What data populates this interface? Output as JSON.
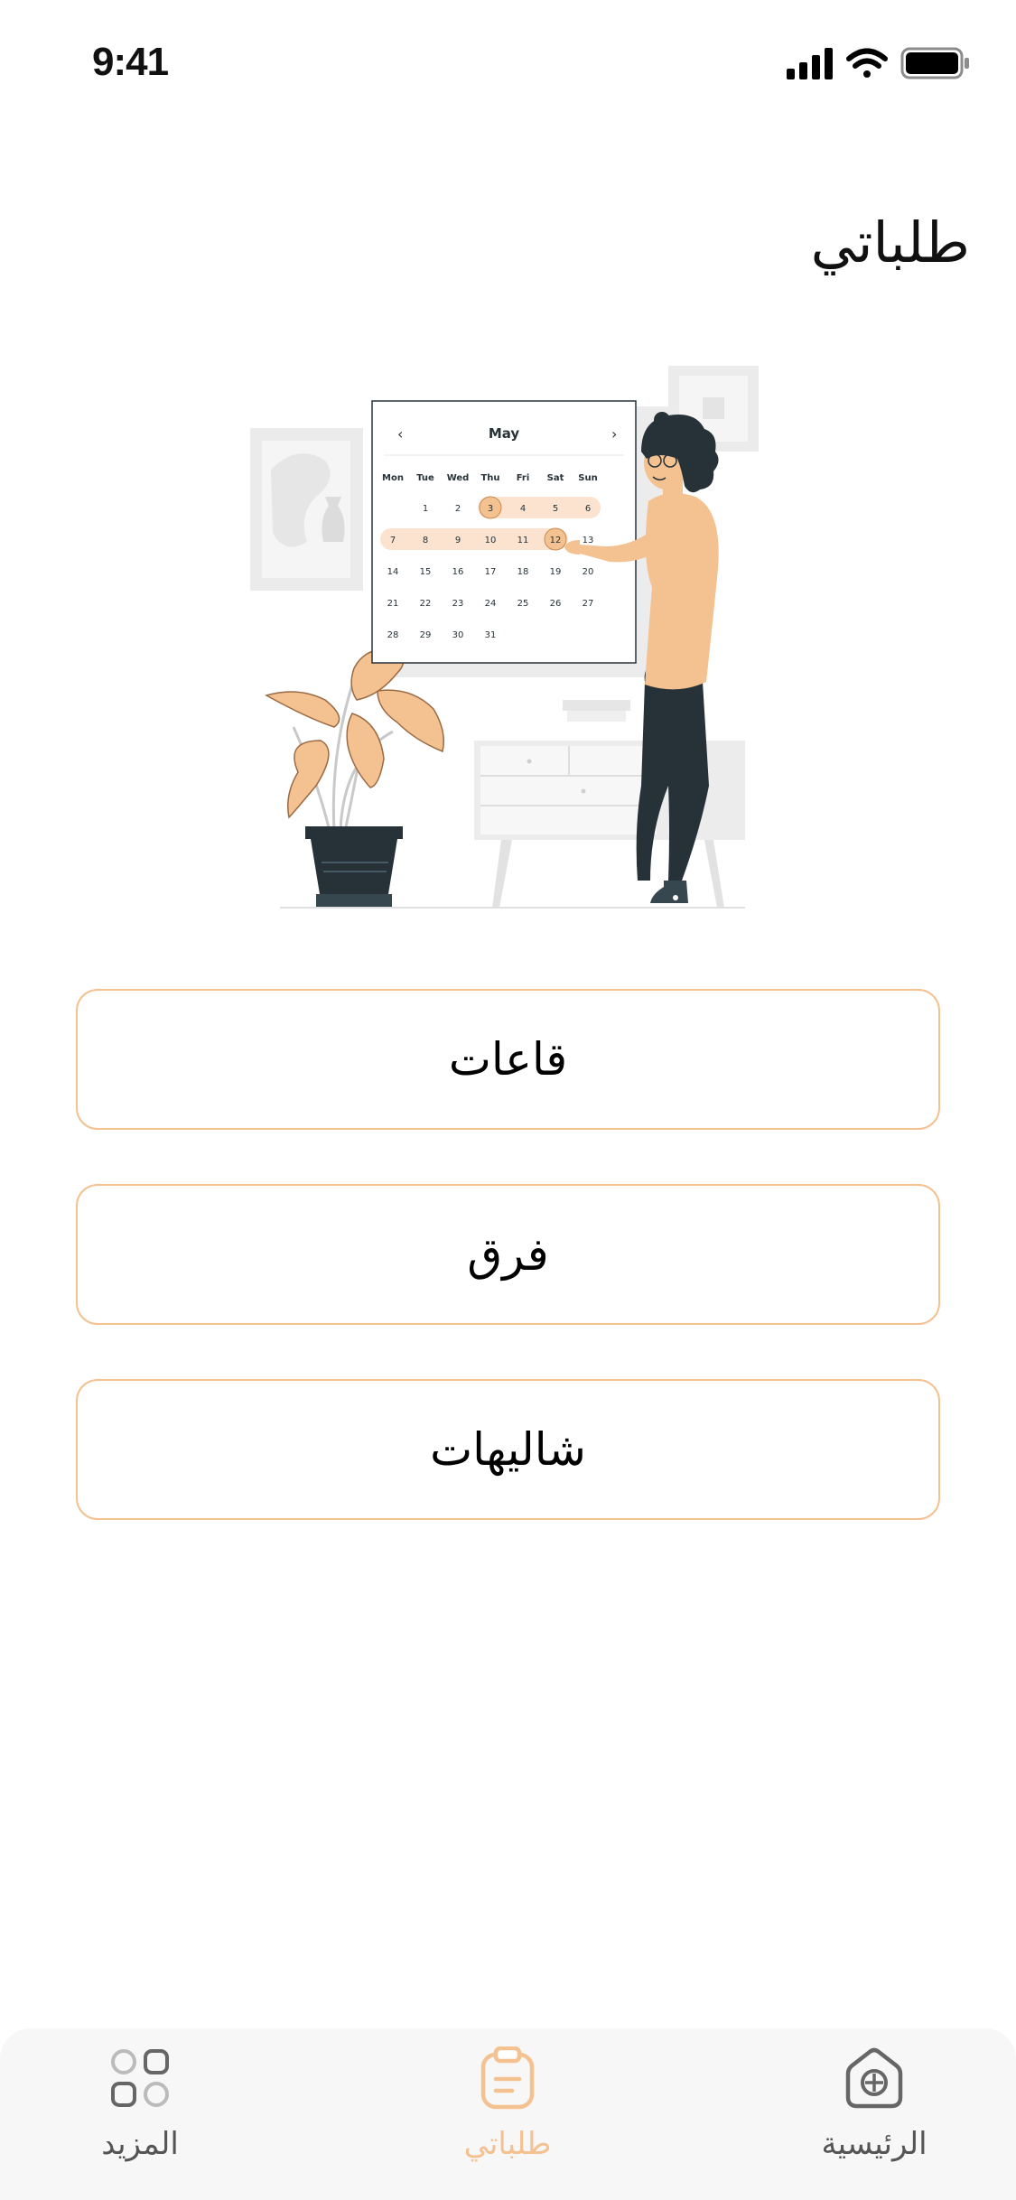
{
  "status_bar": {
    "time": "9:41"
  },
  "header": {
    "title": "طلباتي"
  },
  "illustration": {
    "calendar_month": "May",
    "weekdays": [
      "Mon",
      "Tue",
      "Wed",
      "Thu",
      "Fri",
      "Sat",
      "Sun"
    ],
    "weeks": [
      [
        "",
        "1",
        "2",
        "3",
        "4",
        "5",
        "6"
      ],
      [
        "7",
        "8",
        "9",
        "10",
        "11",
        "12",
        "13"
      ],
      [
        "14",
        "15",
        "16",
        "17",
        "18",
        "19",
        "20"
      ],
      [
        "21",
        "22",
        "23",
        "24",
        "25",
        "26",
        "27"
      ],
      [
        "28",
        "29",
        "30",
        "31",
        "",
        "",
        ""
      ]
    ],
    "selected_days": [
      "3",
      "12"
    ]
  },
  "categories": [
    {
      "label": "قاعات"
    },
    {
      "label": "فرق"
    },
    {
      "label": "شاليهات"
    }
  ],
  "bottom_nav": {
    "more": {
      "label": "المزيد",
      "icon": "grid-icon"
    },
    "orders": {
      "label": "طلباتي",
      "icon": "clipboard-icon",
      "active": true
    },
    "home": {
      "label": "الرئيسية",
      "icon": "home-icon"
    }
  },
  "colors": {
    "accent": "#F4C190",
    "accent_light": "#FBE3CF",
    "dark": "#263238",
    "inactive_icon": "#666666"
  }
}
